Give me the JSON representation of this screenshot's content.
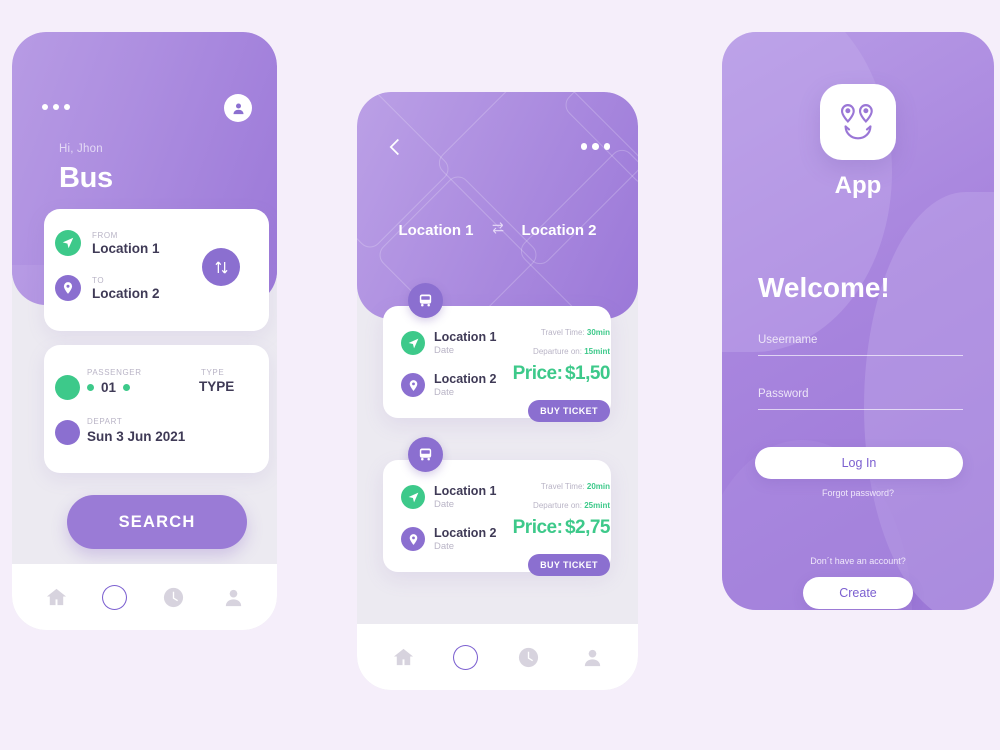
{
  "background_color": "#f5eefa",
  "theme": {
    "purple": "#8b6fd0",
    "purple_dark": "#7b5fd0",
    "purple_light": "#b79be4",
    "green": "#3dc98a",
    "text_dark": "#3f3a56",
    "text_muted": "#b9b4c6",
    "white": "#ffffff"
  },
  "phone1": {
    "greeting": "Hi, Jhon",
    "title": "Bus",
    "icons": {
      "menu": "more-dots-icon",
      "avatar": "user-avatar-icon"
    },
    "route_card": {
      "from": {
        "label": "FROM",
        "value": "Location 1",
        "icon": "navigation-arrow-icon"
      },
      "to": {
        "label": "TO",
        "value": "Location 2",
        "icon": "map-pin-icon"
      },
      "swap_icon": "swap-vertical-arrows-icon"
    },
    "detail_card": {
      "passenger": {
        "label": "PASSENGER",
        "value": "01"
      },
      "type": {
        "label": "TYPE",
        "value": "TYPE"
      },
      "depart": {
        "label": "DEPART",
        "value": "Sun 3 Jun 2021"
      }
    },
    "search_button": "SEARCH",
    "nav": [
      {
        "name": "home",
        "icon": "home-icon",
        "active": false
      },
      {
        "name": "explore",
        "icon": "compass-icon",
        "active": true
      },
      {
        "name": "history",
        "icon": "clock-icon",
        "active": false
      },
      {
        "name": "profile",
        "icon": "person-icon",
        "active": false
      }
    ]
  },
  "phone2": {
    "back_icon": "chevron-left-icon",
    "menu_icon": "more-dots-icon",
    "route": {
      "origin": "Location 1",
      "destination": "Location 2",
      "swap_icon": "swap-horizontal-arrows-icon"
    },
    "tickets": [
      {
        "badge_icon": "bus-icon",
        "from": "Location 1",
        "from_date": "Date",
        "to": "Location 2",
        "to_date": "Date",
        "travel_time_label": "Travel Time:",
        "travel_time_value": "30min",
        "departure_label": "Departure on:",
        "departure_value": "15mint",
        "price_label": "Price:",
        "price_value": "$1,50",
        "buy_label": "BUY TICKET"
      },
      {
        "badge_icon": "bus-icon",
        "from": "Location 1",
        "from_date": "Date",
        "to": "Location 2",
        "to_date": "Date",
        "travel_time_label": "Travel Time:",
        "travel_time_value": "20min",
        "departure_label": "Departure on:",
        "departure_value": "25mint",
        "price_label": "Price:",
        "price_value": "$2,75",
        "buy_label": "BUY TICKET"
      }
    ],
    "nav": [
      {
        "name": "home",
        "icon": "home-icon",
        "active": false
      },
      {
        "name": "explore",
        "icon": "compass-icon",
        "active": true
      },
      {
        "name": "history",
        "icon": "clock-icon",
        "active": false
      },
      {
        "name": "profile",
        "icon": "person-icon",
        "active": false
      }
    ]
  },
  "phone3": {
    "logo_icon": "smiley-map-pins-logo",
    "app_name": "App",
    "welcome": "Welcome!",
    "username_placeholder": "Useername",
    "password_placeholder": "Password",
    "login_button": "Log In",
    "forgot_link": "Forgot password?",
    "no_account_text": "Don´t have an account?",
    "create_button": "Create"
  }
}
